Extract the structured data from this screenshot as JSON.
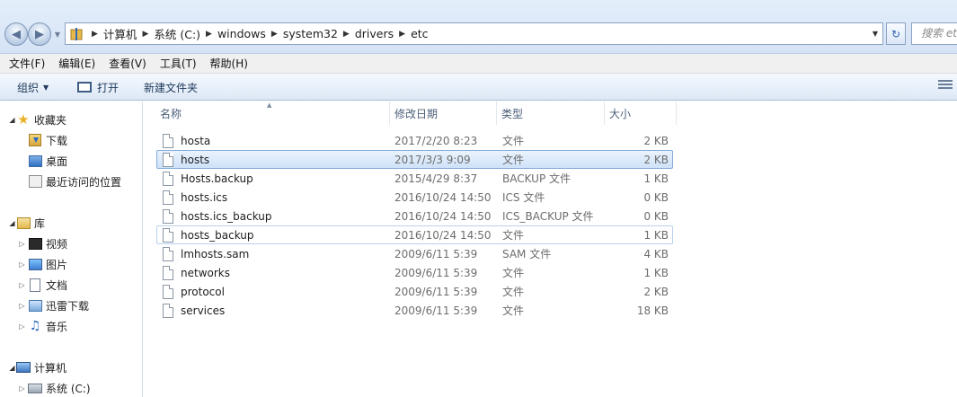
{
  "address": {
    "crumbs": [
      "计算机",
      "系统 (C:)",
      "windows",
      "system32",
      "drivers",
      "etc"
    ],
    "search_placeholder": "搜索 etc"
  },
  "menu": [
    "文件(F)",
    "编辑(E)",
    "查看(V)",
    "工具(T)",
    "帮助(H)"
  ],
  "toolbar": {
    "organize_label": "组织",
    "open_label": "打开",
    "new_folder_label": "新建文件夹"
  },
  "nav": {
    "favorites": "收藏夹",
    "downloads": "下载",
    "desktop": "桌面",
    "recent": "最近访问的位置",
    "libraries": "库",
    "videos": "视频",
    "pictures": "图片",
    "documents": "文档",
    "thunder": "迅雷下载",
    "music": "音乐",
    "computer": "计算机",
    "system_drive": "系统 (C:)"
  },
  "columns": {
    "name": "名称",
    "date": "修改日期",
    "type": "类型",
    "size": "大小"
  },
  "files": [
    {
      "name": "hosta",
      "date": "2017/2/20 8:23",
      "type": "文件",
      "size": "2 KB"
    },
    {
      "name": "hosts",
      "date": "2017/3/3 9:09",
      "type": "文件",
      "size": "2 KB"
    },
    {
      "name": "Hosts.backup",
      "date": "2015/4/29 8:37",
      "type": "BACKUP 文件",
      "size": "1 KB"
    },
    {
      "name": "hosts.ics",
      "date": "2016/10/24 14:50",
      "type": "ICS 文件",
      "size": "0 KB"
    },
    {
      "name": "hosts.ics_backup",
      "date": "2016/10/24 14:50",
      "type": "ICS_BACKUP 文件",
      "size": "0 KB"
    },
    {
      "name": "hosts_backup",
      "date": "2016/10/24 14:50",
      "type": "文件",
      "size": "1 KB"
    },
    {
      "name": "lmhosts.sam",
      "date": "2009/6/11 5:39",
      "type": "SAM 文件",
      "size": "4 KB"
    },
    {
      "name": "networks",
      "date": "2009/6/11 5:39",
      "type": "文件",
      "size": "1 KB"
    },
    {
      "name": "protocol",
      "date": "2009/6/11 5:39",
      "type": "文件",
      "size": "2 KB"
    },
    {
      "name": "services",
      "date": "2009/6/11 5:39",
      "type": "文件",
      "size": "18 KB"
    }
  ]
}
